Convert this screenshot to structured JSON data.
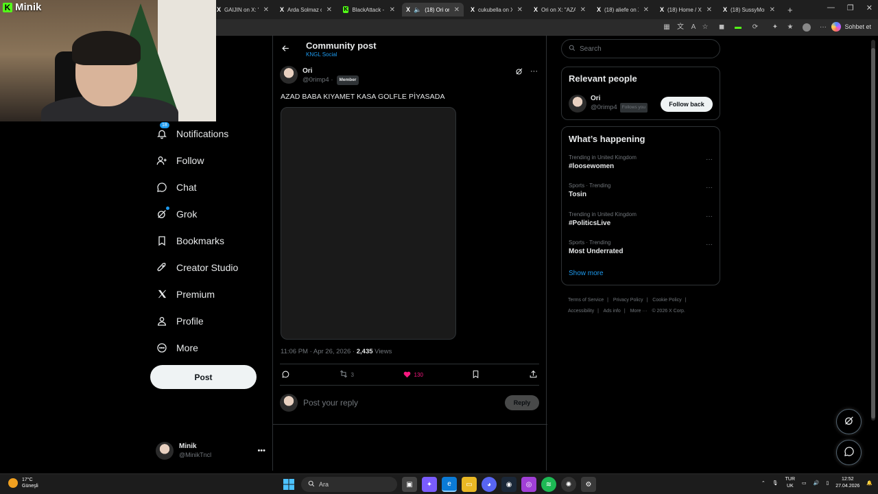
{
  "browser": {
    "tabs": [
      {
        "label": "GAIJIN on X: \"...\"",
        "icon": "x-icon"
      },
      {
        "label": "Arda Solmaz on X",
        "icon": "x-icon"
      },
      {
        "label": "BlackAttack - ...",
        "icon": "kick-icon"
      },
      {
        "label": "(18) Ori on X",
        "icon": "x-icon",
        "active": true
      },
      {
        "label": "cukubella on X",
        "icon": "x-icon"
      },
      {
        "label": "Ori on X: \"AZAD...\"",
        "icon": "x-icon"
      },
      {
        "label": "(18) aliefe on X",
        "icon": "x-icon"
      },
      {
        "label": "(18) Home / X",
        "icon": "x-icon"
      },
      {
        "label": "(18) SussyMoni...",
        "icon": "x-icon"
      }
    ],
    "copilot_label": "Sohbet et"
  },
  "stream": {
    "brand": "Minik"
  },
  "nav": {
    "notifications_badge": "18",
    "items": [
      {
        "label": "Notifications",
        "icon": "bell-icon"
      },
      {
        "label": "Follow",
        "icon": "person-plus-icon"
      },
      {
        "label": "Chat",
        "icon": "chat-icon"
      },
      {
        "label": "Grok",
        "icon": "grok-icon"
      },
      {
        "label": "Bookmarks",
        "icon": "bookmark-icon"
      },
      {
        "label": "Creator Studio",
        "icon": "rocket-icon"
      },
      {
        "label": "Premium",
        "icon": "x-logo-icon"
      },
      {
        "label": "Profile",
        "icon": "person-icon"
      },
      {
        "label": "More",
        "icon": "more-circle-icon"
      }
    ],
    "post_button": "Post",
    "account": {
      "name": "Minik",
      "handle": "@MinikTncl"
    }
  },
  "post": {
    "header_title": "Community post",
    "header_subtitle": "KNGL Social",
    "author_name": "Ori",
    "author_handle": "@0rimp4 ·",
    "member_badge": "Member",
    "text": "AZAD BABA KIYAMET KASA GOLFLE PİYASADA",
    "timestamp": "11:06 PM · Apr 26, 2026 ·",
    "views_count": "2,435",
    "views_label": "Views",
    "reposts": "3",
    "likes": "130",
    "reply_placeholder": "Post your reply",
    "reply_button": "Reply"
  },
  "sidebar": {
    "search_placeholder": "Search",
    "relevant_title": "Relevant people",
    "relevant_person": {
      "name": "Ori",
      "handle": "@0rimp4",
      "follows_you": "Follows you",
      "button": "Follow back"
    },
    "happening_title": "What’s happening",
    "trends": [
      {
        "context": "Trending in United Kingdom",
        "name": "#loosewomen"
      },
      {
        "context": "Sports · Trending",
        "name": "Tosin"
      },
      {
        "context": "Trending in United Kingdom",
        "name": "#PoliticsLive"
      },
      {
        "context": "Sports · Trending",
        "name": "Most Underrated"
      }
    ],
    "show_more": "Show more",
    "footer": [
      "Terms of Service",
      "|",
      "Privacy Policy",
      "|",
      "Cookie Policy",
      "|",
      "Accessibility",
      "|",
      "Ads info",
      "|",
      "More ···",
      "© 2026 X Corp."
    ]
  },
  "taskbar": {
    "weather_temp": "17°C",
    "weather_desc": "Güneşli",
    "search_label": "Ara",
    "lang_top": "TUR",
    "lang_bottom": "UK",
    "time": "12:52",
    "date": "27.04.2026"
  },
  "colors": {
    "accent": "#1d9bf0",
    "like": "#f91880",
    "kick": "#53fc18"
  }
}
